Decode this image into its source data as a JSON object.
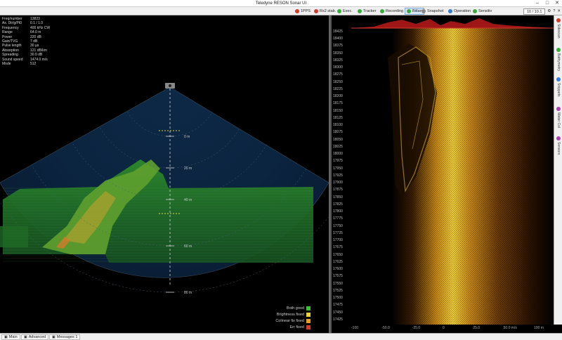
{
  "window": {
    "title": "Teledyne RESON Sonar UI"
  },
  "toolbar": {
    "items": [
      {
        "label": "1PPS",
        "color": "#d23b2b"
      },
      {
        "label": "Rx2 stab.",
        "color": "#d23b2b"
      },
      {
        "label": "Exec.",
        "color": "#3caa3c"
      },
      {
        "label": "Tracker",
        "color": "#3caa3c"
      },
      {
        "label": "Recording",
        "color": "#3caa3c"
      },
      {
        "label": "Bitlan",
        "color": "#3caa3c"
      },
      {
        "label": "Snapshot",
        "color": "#888888"
      },
      {
        "label": "Operation",
        "color": "#3a7bd5"
      },
      {
        "label": "Sensitiv",
        "color": "#3caa3c"
      }
    ],
    "range_value": "10 / 10.1"
  },
  "params": [
    {
      "k": "Freq/number",
      "v": "13823"
    },
    {
      "k": "Ax. Dir/g/Pt0",
      "v": "0.1 / 1.0"
    },
    {
      "k": "Frequency",
      "v": "400 kHz CW"
    },
    {
      "k": "Range",
      "v": "64.0 m"
    },
    {
      "k": "Power",
      "v": "220 dB"
    },
    {
      "k": "Gain/TVG",
      "v": "7 dB"
    },
    {
      "k": "Pulse length",
      "v": "30 µs"
    },
    {
      "k": "Absorption",
      "v": "121 dB/km"
    },
    {
      "k": "Spreading",
      "v": "30.0 dB"
    },
    {
      "k": "Sound speed",
      "v": "1474.0 m/s"
    },
    {
      "k": "Mode",
      "v": "512"
    }
  ],
  "fan": {
    "range_labels": [
      "0 m",
      "20 m",
      "40 m",
      "60 m",
      "80 m"
    ],
    "boat_icon": "transducer-icon"
  },
  "legend": [
    {
      "label": "Both good",
      "color": "#3cbe3c"
    },
    {
      "label": "Brightness fixed",
      "color": "#e8d43a"
    },
    {
      "label": "Colinear fix fixed",
      "color": "#e8a020"
    },
    {
      "label": "Err fixed",
      "color": "#d23b2b"
    }
  ],
  "sidescan": {
    "depth_labels": [
      "18425",
      "18400",
      "18375",
      "18350",
      "18325",
      "18300",
      "18275",
      "18250",
      "18225",
      "18200",
      "18175",
      "18150",
      "18125",
      "18100",
      "18075",
      "18050",
      "18025",
      "18000",
      "17975",
      "17950",
      "17925",
      "17900",
      "17875",
      "17850",
      "17825",
      "17800",
      "17775",
      "17750",
      "17725",
      "17700",
      "17675",
      "17650",
      "17625",
      "17600",
      "17575",
      "17550",
      "17525",
      "17500",
      "17475",
      "17450",
      "17425"
    ],
    "x_labels": [
      "-100",
      "-50.0",
      "-25.0",
      "0",
      "25.0",
      "50.0 m/s",
      "100 m"
    ]
  },
  "side_tabs": [
    {
      "label": "Sidescan",
      "icon": "sidescan-icon",
      "color": "#d23b2b"
    },
    {
      "label": "Bathymetry",
      "icon": "bathy-icon",
      "color": "#3caa3c"
    },
    {
      "label": "Snippets",
      "icon": "snippets-icon",
      "color": "#3a7bd5"
    },
    {
      "label": "Water Col",
      "icon": "watercol-icon",
      "color": "#aa44aa"
    },
    {
      "label": "Sensors",
      "icon": "sensors-icon",
      "color": "#aa44aa"
    }
  ],
  "status_tabs": [
    {
      "label": "Main",
      "icon": "main-icon"
    },
    {
      "label": "Advanced",
      "icon": "advanced-icon"
    },
    {
      "label": "Messages 1",
      "icon": "messages-icon"
    }
  ]
}
